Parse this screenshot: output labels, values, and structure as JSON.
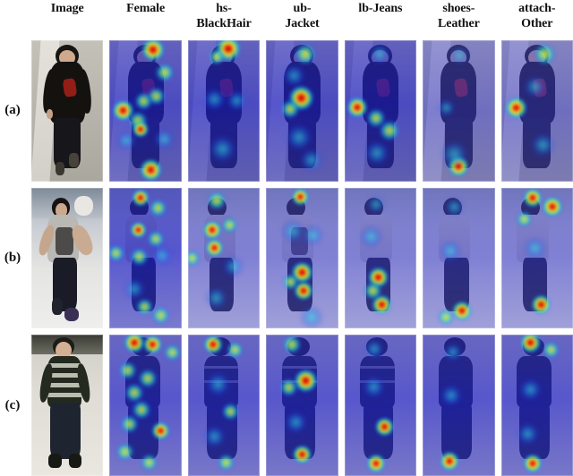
{
  "figure": {
    "type": "attention-heatmap-grid",
    "row_label_header": "",
    "columns": [
      {
        "id": "image",
        "label": "Image",
        "label_lines": [
          "Image"
        ]
      },
      {
        "id": "female",
        "label": "Female",
        "label_lines": [
          "Female"
        ]
      },
      {
        "id": "hs-blackhair",
        "label": "hs-BlackHair",
        "label_lines": [
          "hs-",
          "BlackHair"
        ]
      },
      {
        "id": "ub-jacket",
        "label": "ub-Jacket",
        "label_lines": [
          "ub-",
          "Jacket"
        ]
      },
      {
        "id": "lb-jeans",
        "label": "lb-Jeans",
        "label_lines": [
          "lb-Jeans"
        ]
      },
      {
        "id": "shoes-leather",
        "label": "shoes-Leather",
        "label_lines": [
          "shoes-",
          "Leather"
        ]
      },
      {
        "id": "attach-other",
        "label": "attach-Other",
        "label_lines": [
          "attach-",
          "Other"
        ]
      }
    ],
    "rows": [
      {
        "id": "a",
        "label": "(a)",
        "subject": "woman in black long-sleeve top with red script logo, dark trousers, walking on light pavement"
      },
      {
        "id": "b",
        "label": "(b)",
        "subject": "young man in grey printed t-shirt, dark jeans, purple sneakers, indoor tiled floor"
      },
      {
        "id": "c",
        "label": "(c)",
        "subject": "man in dark horizontally-striped sweater, dark trousers, dark shoes, light floor"
      }
    ],
    "colors": {
      "background": "#ffffff",
      "text": "#111111",
      "heat_low": "#1e1ec8",
      "heat_mid_cyan": "#28e1cd",
      "heat_mid_green": "#96f55a",
      "heat_mid_yellow": "#ffd728",
      "heat_high": "#aa0000"
    }
  }
}
